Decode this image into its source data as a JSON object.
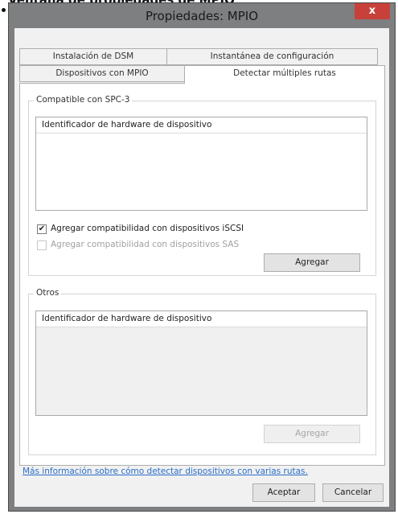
{
  "header_fragment": "Ventana de propiedades de MPIO",
  "window": {
    "title": "Propiedades: MPIO",
    "close_glyph": "x"
  },
  "tabs": {
    "row1": [
      "Instalación de DSM",
      "Instantánea de configuración"
    ],
    "row2": [
      "Dispositivos con MPIO",
      "Detectar múltiples rutas"
    ],
    "active": "Detectar múltiples rutas"
  },
  "spc3": {
    "group_label": "Compatible con SPC-3",
    "list_header": "Identificador de hardware de dispositivo",
    "iscsi": {
      "label": "Agregar compatibilidad con dispositivos iSCSI",
      "checked": true,
      "check_glyph": "✔"
    },
    "sas": {
      "label": "Agregar compatibilidad con dispositivos SAS",
      "checked": false,
      "enabled": false
    },
    "add_button": "Agregar"
  },
  "otros": {
    "group_label": "Otros",
    "list_header": "Identificador de hardware de dispositivo",
    "add_button": "Agregar"
  },
  "link": "Más información sobre cómo detectar dispositivos con varias rutas.",
  "footer": {
    "ok": "Aceptar",
    "cancel": "Cancelar"
  }
}
